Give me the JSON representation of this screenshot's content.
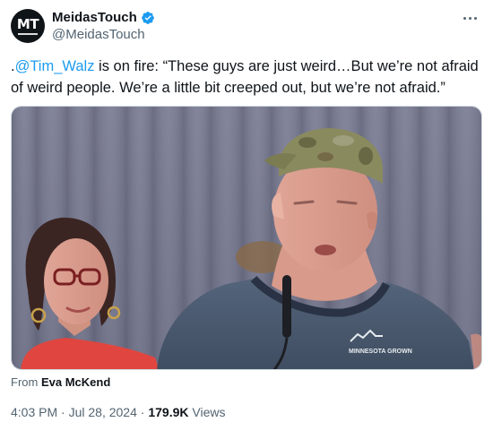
{
  "author": {
    "avatar_initials": "MT",
    "display_name": "MeidasTouch",
    "handle": "@MeidasTouch",
    "verified": true
  },
  "tweet": {
    "prefix": ".",
    "mention": "@Tim_Walz",
    "body": " is on fire: “These guys are just weird…But we’re not afraid of weird people. We’re a little bit creeped out, but we’re not afraid.”"
  },
  "media": {
    "shirt_logo_text": "MINNESOTA GROWN"
  },
  "attribution": {
    "prefix": "From",
    "name": "Eva McKend"
  },
  "meta": {
    "time": "4:03 PM",
    "separator": "·",
    "date": "Jul 28, 2024",
    "views_count": "179.9K",
    "views_label": "Views"
  },
  "colors": {
    "link": "#1d9bf0",
    "verified": "#1d9bf0",
    "secondary_text": "#536471"
  }
}
